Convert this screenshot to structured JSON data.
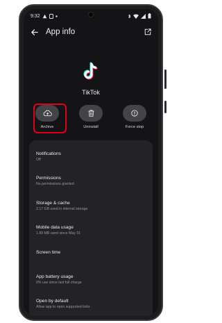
{
  "status_bar": {
    "time": "9:32",
    "icons": [
      "notification-icon",
      "clipboard-icon",
      "dot-icon",
      "bluetooth-icon",
      "wifi-icon",
      "signal-icon",
      "battery-icon"
    ]
  },
  "header": {
    "title": "App info",
    "back_icon": "back-arrow-icon",
    "external_icon": "open-external-icon"
  },
  "app": {
    "name": "TikTok",
    "icon": "tiktok-logo-icon"
  },
  "actions": [
    {
      "label": "Archive",
      "icon": "cloud-upload-icon",
      "highlighted": true
    },
    {
      "label": "Uninstall",
      "icon": "trash-icon"
    },
    {
      "label": "Force stop",
      "icon": "info-icon"
    }
  ],
  "settings": [
    {
      "title": "Notifications",
      "subtitle": "Off"
    },
    {
      "title": "Permissions",
      "subtitle": "No permissions granted"
    },
    {
      "title": "Storage & cache",
      "subtitle": "2.17 GB used in internal storage"
    },
    {
      "title": "Mobile data usage",
      "subtitle": "1.89 MB used since May 31"
    },
    {
      "title": "Screen time",
      "subtitle": ""
    },
    {
      "title": "App battery usage",
      "subtitle": "0% use since last full charge"
    },
    {
      "title": "Open by default",
      "subtitle": "Allow app to open supported links"
    }
  ],
  "colors": {
    "highlight": "#e0001b",
    "screen_bg": "#141416",
    "card_bg": "#232325",
    "button_bg": "#444347"
  }
}
